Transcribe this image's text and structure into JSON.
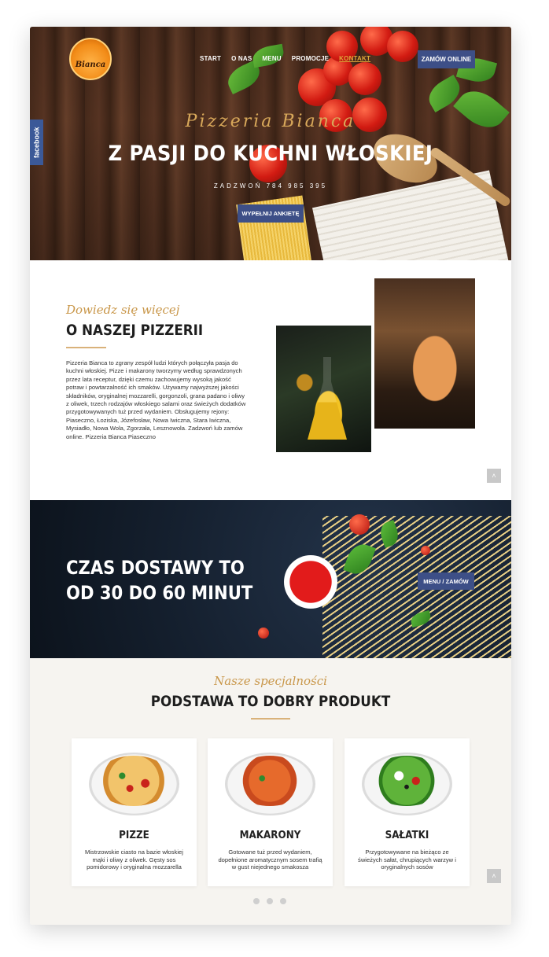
{
  "header": {
    "logo_text": "Bianca",
    "nav": [
      {
        "label": "START",
        "active": false
      },
      {
        "label": "O NAS",
        "active": false
      },
      {
        "label": "MENU",
        "active": false
      },
      {
        "label": "PROMOCJE",
        "active": false
      },
      {
        "label": "KONTAKT",
        "active": true
      }
    ],
    "order_button": "ZAMÓW ONLINE"
  },
  "social": {
    "facebook_tab": "facebook"
  },
  "hero": {
    "script_title": "Pizzeria Bianca",
    "title": "Z PASJI DO KUCHNI WŁOSKIEJ",
    "phone": "ZADZWOŃ 784 985 395",
    "survey_button": "WYPEŁNIJ ANKIETĘ"
  },
  "about": {
    "script_title": "Dowiedz się więcej",
    "title": "O NASZEJ PIZZERII",
    "text": "Pizzeria Bianca to zgrany zespół ludzi których połączyła pasja do kuchni włoskiej. Pizze i makarony tworzymy według sprawdzonych przez lata receptur, dzięki czemu zachowujemy wysoką jakość potraw i powtarzalność ich smaków. Używamy najwyższej jakości składników, oryginalnej mozzarelli, gorgonzoli, grana padano i oliwy z oliwek, trzech rodzajów włoskiego salami oraz świeżych dodatków przygotowywanych tuż przed wydaniem. Obsługujemy rejony: Piaseczno, Łoziska, Józefosław, Nowa Iwiczna, Stara Iwiczna, Mysiadło, Nowa Wola, Zgorzała, Lesznowola. Zadzwoń lub zamów online. Pizzeria Bianca Piaseczno"
  },
  "delivery": {
    "title_line1": "CZAS DOSTAWY TO",
    "title_line2": "OD 30 DO 60 MINUT",
    "menu_button": "MENU / ZAMÓW"
  },
  "specialties": {
    "script_title": "Nasze specjalności",
    "title": "PODSTAWA TO DOBRY PRODUKT",
    "cards": [
      {
        "title": "PIZZE",
        "desc": "Mistrzowskie ciasto na bazie włoskiej mąki i oliwy z oliwek. Gęsty sos pomidorowy i oryginalna mozzarella"
      },
      {
        "title": "MAKARONY",
        "desc": "Gotowane tuż przed wydaniem, dopełnione aromatycznym sosem trafią w gust niejednego smakosza"
      },
      {
        "title": "SAŁATKI",
        "desc": "Przygotowywane na bieżąco ze świeżych sałat, chrupiących warzyw i oryginalnych sosów"
      }
    ]
  },
  "icons": {
    "scroll_top": "chevron-up-icon",
    "scroll_glyph": "˄"
  },
  "colors": {
    "accent_button": "#3d4f87",
    "gold": "#c9974a",
    "facebook": "#3b5998"
  }
}
